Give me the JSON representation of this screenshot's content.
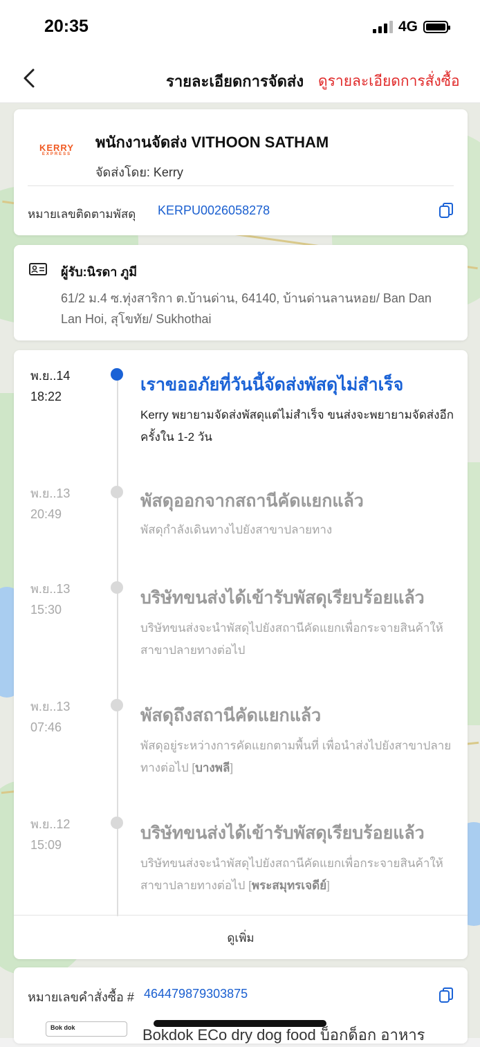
{
  "status_bar": {
    "time": "20:35",
    "network": "4G"
  },
  "nav": {
    "title": "รายละเอียดการจัดส่ง",
    "order_link": "ดูรายละเอียดการสั่งซื้อ"
  },
  "courier": {
    "logo": "KERRY",
    "logo_sub": "EXPRESS",
    "name": "พนักงานจัดส่ง VITHOON SATHAM",
    "delivered_by": "จัดส่งโดย: Kerry",
    "tracking_label": "หมายเลขติดตามพัสดุ",
    "tracking_number": "KERPU0026058278"
  },
  "recipient": {
    "name": "ผู้รับ:นิรดา ภูมี",
    "address": "61/2 ม.4 ซ.ทุ่งสาริกา ต.บ้านด่าน, 64140, บ้านด่านลานหอย/ Ban Dan Lan Hoi, สุโขทัย/ Sukhothai"
  },
  "timeline": {
    "events": [
      {
        "date": "พ.ย..14",
        "time": "18:22",
        "title": "เราขออภัยที่วันนี้จัดส่งพัสดุไม่สำเร็จ",
        "desc": "Kerry พยายามจัดส่งพัสดุแต่ไม่สำเร็จ ขนส่งจะพยายามจัดส่งอีกครั้งใน 1-2 วัน",
        "desc_loc": ""
      },
      {
        "date": "พ.ย..13",
        "time": "20:49",
        "title": "พัสดุออกจากสถานีคัดแยกแล้ว",
        "desc": "พัสดุกำลังเดินทางไปยังสาขาปลายทาง",
        "desc_loc": ""
      },
      {
        "date": "พ.ย..13",
        "time": "15:30",
        "title": "บริษัทขนส่งได้เข้ารับพัสดุเรียบร้อยแล้ว",
        "desc": "บริษัทขนส่งจะนำพัสดุไปยังสถานีคัดแยกเพื่อกระจายสินค้าให้สาขาปลายทางต่อไป",
        "desc_loc": ""
      },
      {
        "date": "พ.ย..13",
        "time": "07:46",
        "title": "พัสดุถึงสถานีคัดแยกแล้ว",
        "desc": "พัสดุอยู่ระหว่างการคัดแยกตามพื้นที่ เพื่อนำส่งไปยังสาขาปลายทางต่อไป [",
        "desc_loc": "บางพลี"
      },
      {
        "date": "พ.ย..12",
        "time": "15:09",
        "title": "บริษัทขนส่งได้เข้ารับพัสดุเรียบร้อยแล้ว",
        "desc": "บริษัทขนส่งจะนำพัสดุไปยังสถานีคัดแยกเพื่อกระจายสินค้าให้สาขาปลายทางต่อไป [",
        "desc_loc": "พระสมุทรเจดีย์"
      }
    ],
    "more_label": "ดูเพิ่ม"
  },
  "order": {
    "label": "หมายเลขคำสั่งซื้อ #",
    "number": "464479879303875",
    "product_thumb": "Bok dok",
    "product_name": "Bokdok ECo dry dog food บ็อกด็อก อาหาร"
  },
  "colors": {
    "accent_blue": "#1a62d6",
    "link_red": "#e02828",
    "kerry_orange": "#f05a22"
  }
}
